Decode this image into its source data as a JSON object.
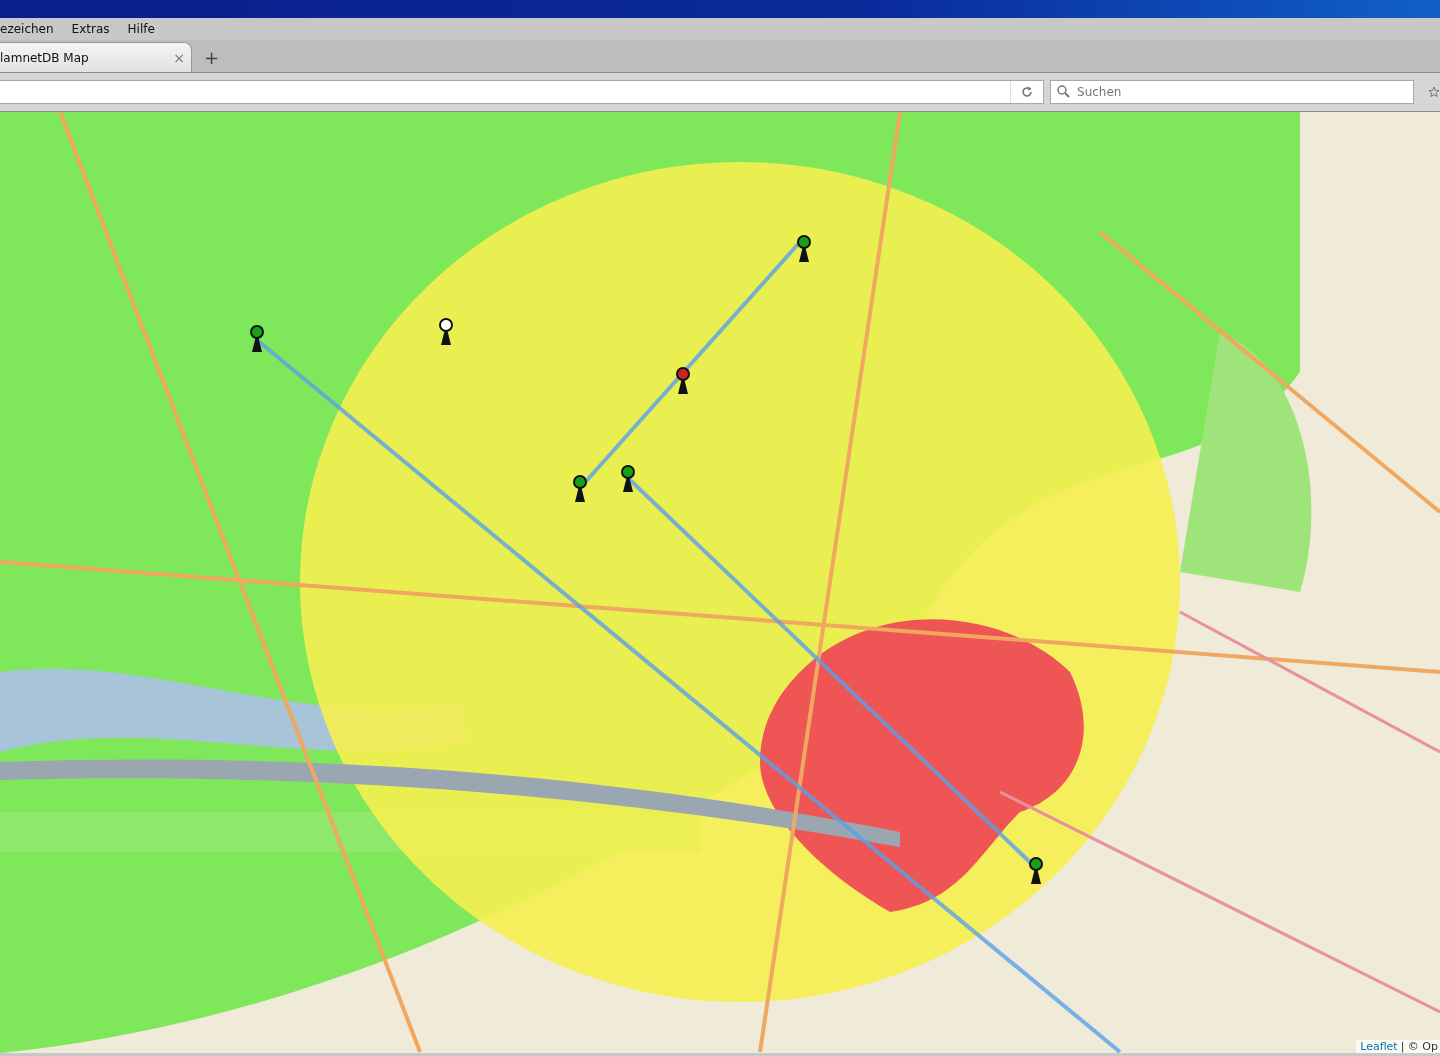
{
  "menu": [
    {
      "label": "ezeichen"
    },
    {
      "label": "Extras"
    },
    {
      "label": "Hilfe"
    }
  ],
  "tabs": [
    {
      "label": "lamnetDB Map",
      "selected": true,
      "close": "×"
    }
  ],
  "new_tab": "+",
  "search": {
    "placeholder": "Suchen"
  },
  "map": {
    "kind": "picture",
    "attribution": {
      "link": "Leaflet",
      "text": "| © Op"
    }
  }
}
